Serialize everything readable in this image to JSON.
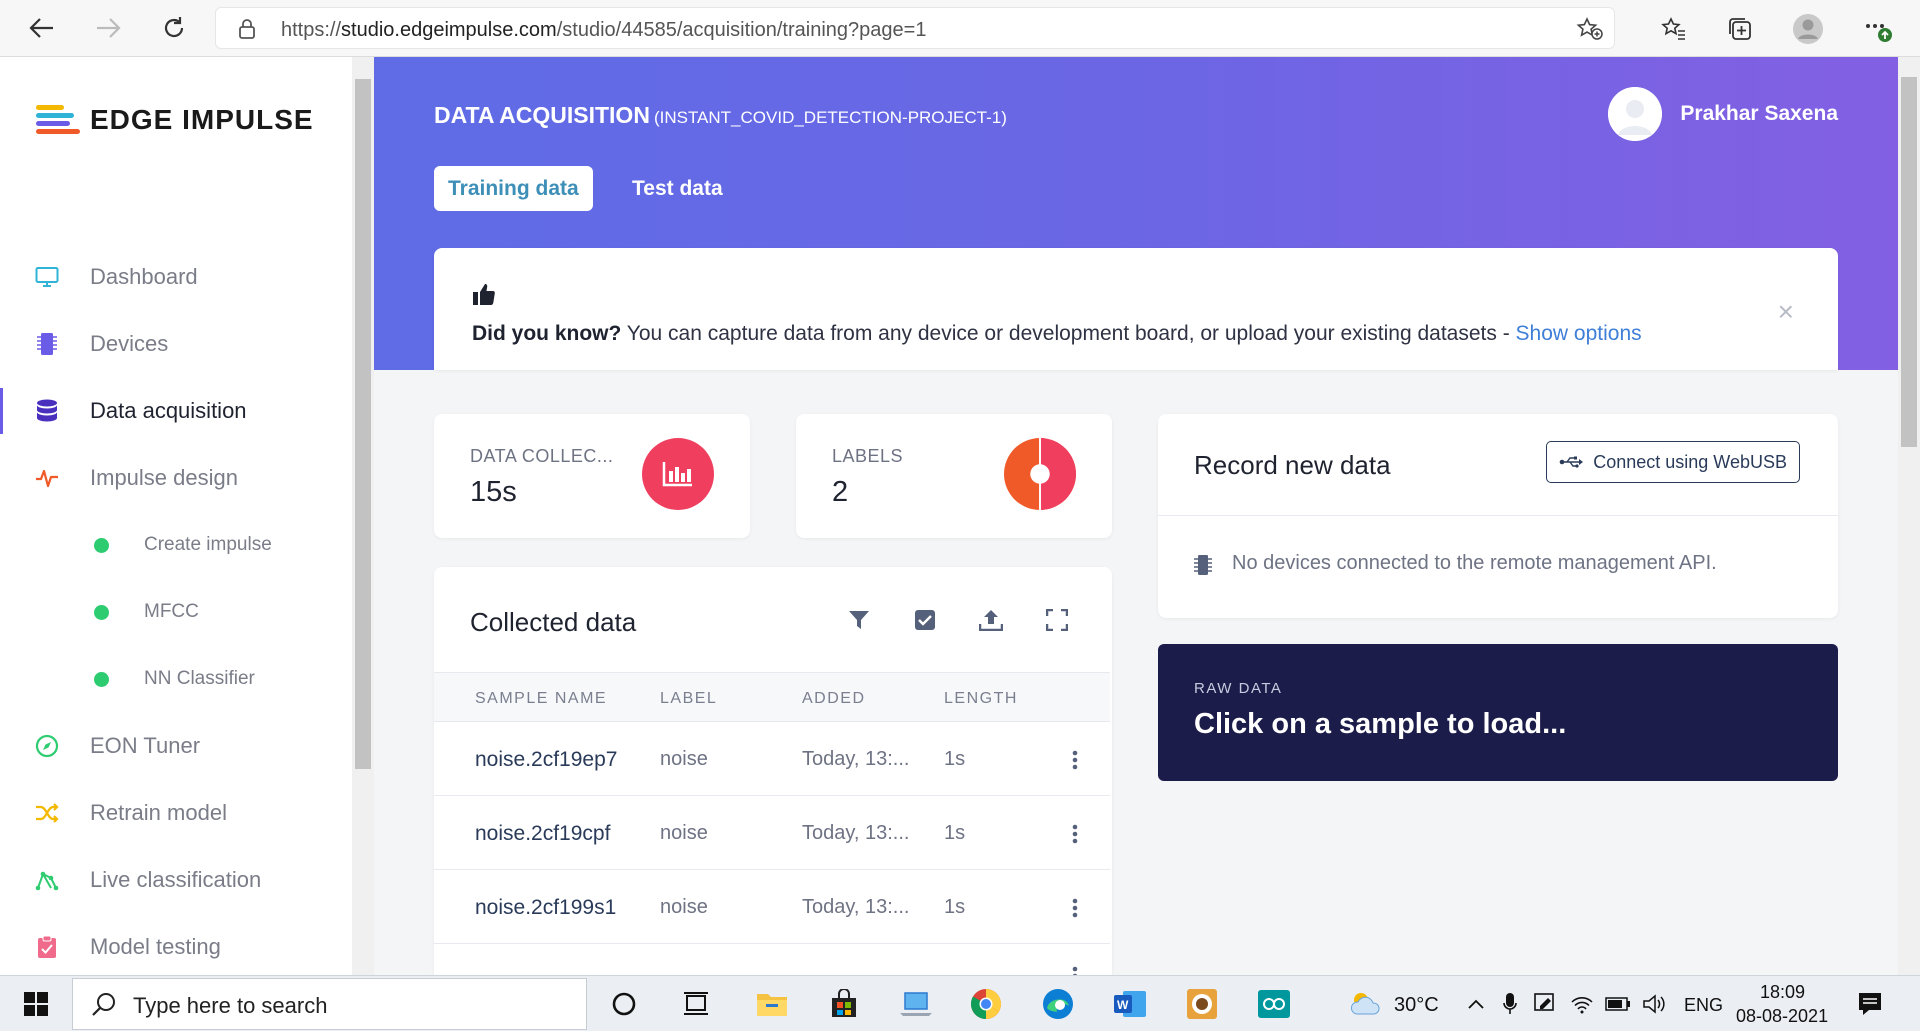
{
  "browser": {
    "url_prefix": "https://",
    "url_host": "studio.edgeimpulse.com",
    "url_path": "/studio/44585/acquisition/training?page=1"
  },
  "brand": {
    "name": "EDGE IMPULSE"
  },
  "sidebar": {
    "items": [
      {
        "label": "Dashboard",
        "icon": "monitor-icon",
        "color": "#2fb4d8"
      },
      {
        "label": "Devices",
        "icon": "chip-icon",
        "color": "#6b5ce7"
      },
      {
        "label": "Data acquisition",
        "icon": "database-icon",
        "color": "#4a2fbf"
      },
      {
        "label": "Impulse design",
        "icon": "pulse-icon",
        "color": "#f05a28"
      },
      {
        "label": "Create impulse",
        "sub": true
      },
      {
        "label": "MFCC",
        "sub": true
      },
      {
        "label": "NN Classifier",
        "sub": true
      },
      {
        "label": "EON Tuner",
        "icon": "compass-icon",
        "color": "#2ecc71"
      },
      {
        "label": "Retrain model",
        "icon": "shuffle-icon",
        "color": "#f5b800"
      },
      {
        "label": "Live classification",
        "icon": "network-icon",
        "color": "#2ecc71"
      },
      {
        "label": "Model testing",
        "icon": "clipboard-check-icon",
        "color": "#f06b8b"
      }
    ]
  },
  "header": {
    "title": "DATA ACQUISITION",
    "project": "(INSTANT_COVID_DETECTION-PROJECT-1)",
    "user_name": "Prakhar Saxena",
    "tabs": [
      {
        "label": "Training data"
      },
      {
        "label": "Test data"
      }
    ]
  },
  "tip": {
    "lead": "Did you know?",
    "text": " You can capture data from any device or development board, or upload your existing datasets - ",
    "link": "Show options",
    "close": "×"
  },
  "stats": {
    "data_collected": {
      "label": "DATA COLLEC...",
      "value": "15s"
    },
    "labels": {
      "label": "LABELS",
      "value": "2"
    }
  },
  "collected": {
    "title": "Collected data",
    "columns": [
      "SAMPLE NAME",
      "LABEL",
      "ADDED",
      "LENGTH"
    ],
    "rows": [
      {
        "name": "noise.2cf19ep7",
        "label": "noise",
        "added": "Today, 13:...",
        "length": "1s"
      },
      {
        "name": "noise.2cf19cpf",
        "label": "noise",
        "added": "Today, 13:...",
        "length": "1s"
      },
      {
        "name": "noise.2cf199s1",
        "label": "noise",
        "added": "Today, 13:...",
        "length": "1s"
      }
    ]
  },
  "record": {
    "title": "Record new data",
    "webusb_label": "Connect using WebUSB",
    "no_devices": "No devices connected to the remote management API."
  },
  "raw_data": {
    "caption": "RAW DATA",
    "message": "Click on a sample to load..."
  },
  "taskbar": {
    "search_placeholder": "Type here to search",
    "weather": "30°C",
    "lang": "ENG",
    "time": "18:09",
    "date": "08-08-2021"
  }
}
